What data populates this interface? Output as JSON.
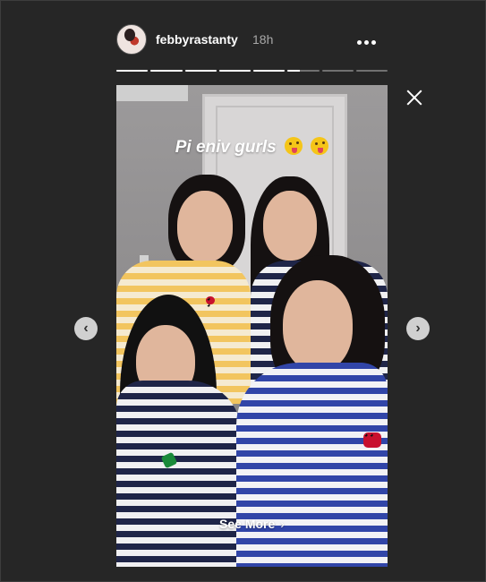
{
  "header": {
    "username": "febbyrastanty",
    "timestamp": "18h",
    "icons": {
      "avatar": "profile-avatar",
      "more": "more-options-icon",
      "close": "close-icon"
    }
  },
  "progress": {
    "segments": 8,
    "completed": 5,
    "current_fraction": 0.4
  },
  "story": {
    "caption": "Pi eniv gurls",
    "caption_emojis": [
      "zany-face-emoji",
      "zany-face-emoji"
    ],
    "see_more_label": "See More",
    "see_more_icon": "chevron-right-icon"
  },
  "navigation": {
    "prev_icon": "chevron-left-icon",
    "next_icon": "chevron-right-icon"
  },
  "colors": {
    "background": "#262626",
    "text": "#ffffff",
    "muted": "#a8a8a8"
  }
}
